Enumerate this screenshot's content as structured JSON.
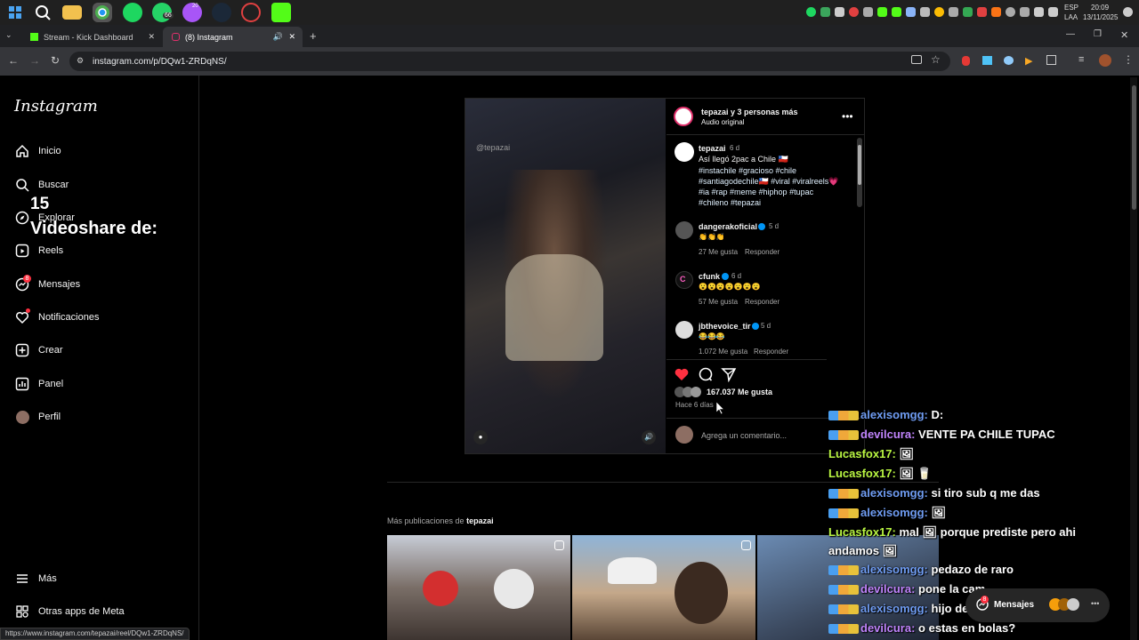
{
  "taskbar": {
    "lang": "ESP",
    "lang_sub": "LAA",
    "time": "20:09",
    "date": "13/11/2025",
    "whatsapp_badge": "66",
    "messenger_badge": "20"
  },
  "browser": {
    "tabs": [
      {
        "label": "Stream - Kick Dashboard"
      },
      {
        "label": "(8) Instagram"
      }
    ],
    "url": "instagram.com/p/DQw1-ZRDqNS/",
    "status_url": "https://www.instagram.com/tepazai/reel/DQw1-ZRDqNS/"
  },
  "sidebar": {
    "logo": "Instagram",
    "items": [
      {
        "label": "Inicio",
        "icon": "home-icon"
      },
      {
        "label": "Buscar",
        "icon": "search-icon"
      },
      {
        "label": "Explorar",
        "icon": "compass-icon"
      },
      {
        "label": "Reels",
        "icon": "reels-icon"
      },
      {
        "label": "Mensajes",
        "icon": "messenger-icon"
      },
      {
        "label": "Notificaciones",
        "icon": "heart-icon"
      },
      {
        "label": "Crear",
        "icon": "plus-square-icon"
      },
      {
        "label": "Panel",
        "icon": "chart-icon"
      },
      {
        "label": "Perfil",
        "icon": "avatar-icon"
      }
    ],
    "messages_badge": "8",
    "more": "Más",
    "meta_apps": "Otras apps de Meta"
  },
  "stream_overlay": {
    "count": "15",
    "caption": "Videoshare de:"
  },
  "post": {
    "header_user": "tepazai y 3 personas más",
    "header_audio": "Audio original",
    "video_watermark": "@tepazai",
    "caption_user": "tepazai",
    "caption_age": "6 d",
    "caption_text": "Así llegó 2pac a Chile 🇨🇱",
    "caption_tags": "#instachile #gracioso #chile #santiagodechile🇨🇱 #viral #viralreels💗 #ia #rap #meme #hiphop #tupac #chileno #tepazai",
    "comments": [
      {
        "user": "dangerakoficial",
        "age": "5 d",
        "text": "👏👏👏",
        "likes": "27 Me gusta",
        "reply": "Responder"
      },
      {
        "user": "cfunk",
        "age": "6 d",
        "text": "😮😮😮😮😮😮😮",
        "likes": "57 Me gusta",
        "reply": "Responder"
      },
      {
        "user": "jbthevoice_tir",
        "age": "5 d",
        "text": "😂😂😂",
        "likes": "1.072 Me gusta",
        "reply": "Responder"
      }
    ],
    "likes": "167.037 Me gusta",
    "posted": "Hace 6 días",
    "comment_placeholder": "Agrega un comentario..."
  },
  "more_posts": {
    "label": "Más publicaciones de",
    "user": "tepazai"
  },
  "messages_pill": {
    "label": "Mensajes",
    "badge": "8"
  },
  "chat": [
    {
      "user": "alexisomgg:",
      "msg": "D:",
      "badges": true,
      "style": "a"
    },
    {
      "user": "devilcura:",
      "msg": "VENTE PA CHILE TUPAC",
      "badges": true,
      "style": "b"
    },
    {
      "user": "Lucasfox17:",
      "msg": "🖼",
      "badges": false,
      "style": "c"
    },
    {
      "user": "Lucasfox17:",
      "msg": "🖼 🥛",
      "badges": false,
      "style": "c"
    },
    {
      "user": "alexisomgg:",
      "msg": "si tiro sub q me das",
      "badges": true,
      "style": "a"
    },
    {
      "user": "alexisomgg:",
      "msg": "🖼",
      "badges": true,
      "style": "a"
    },
    {
      "user": "Lucasfox17:",
      "msg": "mal 🖼 porque prediste pero ahi",
      "badges": false,
      "style": "c"
    },
    {
      "user": "",
      "msg": "andamos 🖼",
      "badges": false,
      "style": "c"
    },
    {
      "user": "alexisomgg:",
      "msg": "pedazo de raro",
      "badges": true,
      "style": "a"
    },
    {
      "user": "devilcura:",
      "msg": "pone la cam",
      "badges": true,
      "style": "b"
    },
    {
      "user": "alexisomgg:",
      "msg": "hijo de buta",
      "badges": true,
      "style": "a"
    },
    {
      "user": "devilcura:",
      "msg": "o estas en bolas?",
      "badges": true,
      "style": "b"
    }
  ]
}
